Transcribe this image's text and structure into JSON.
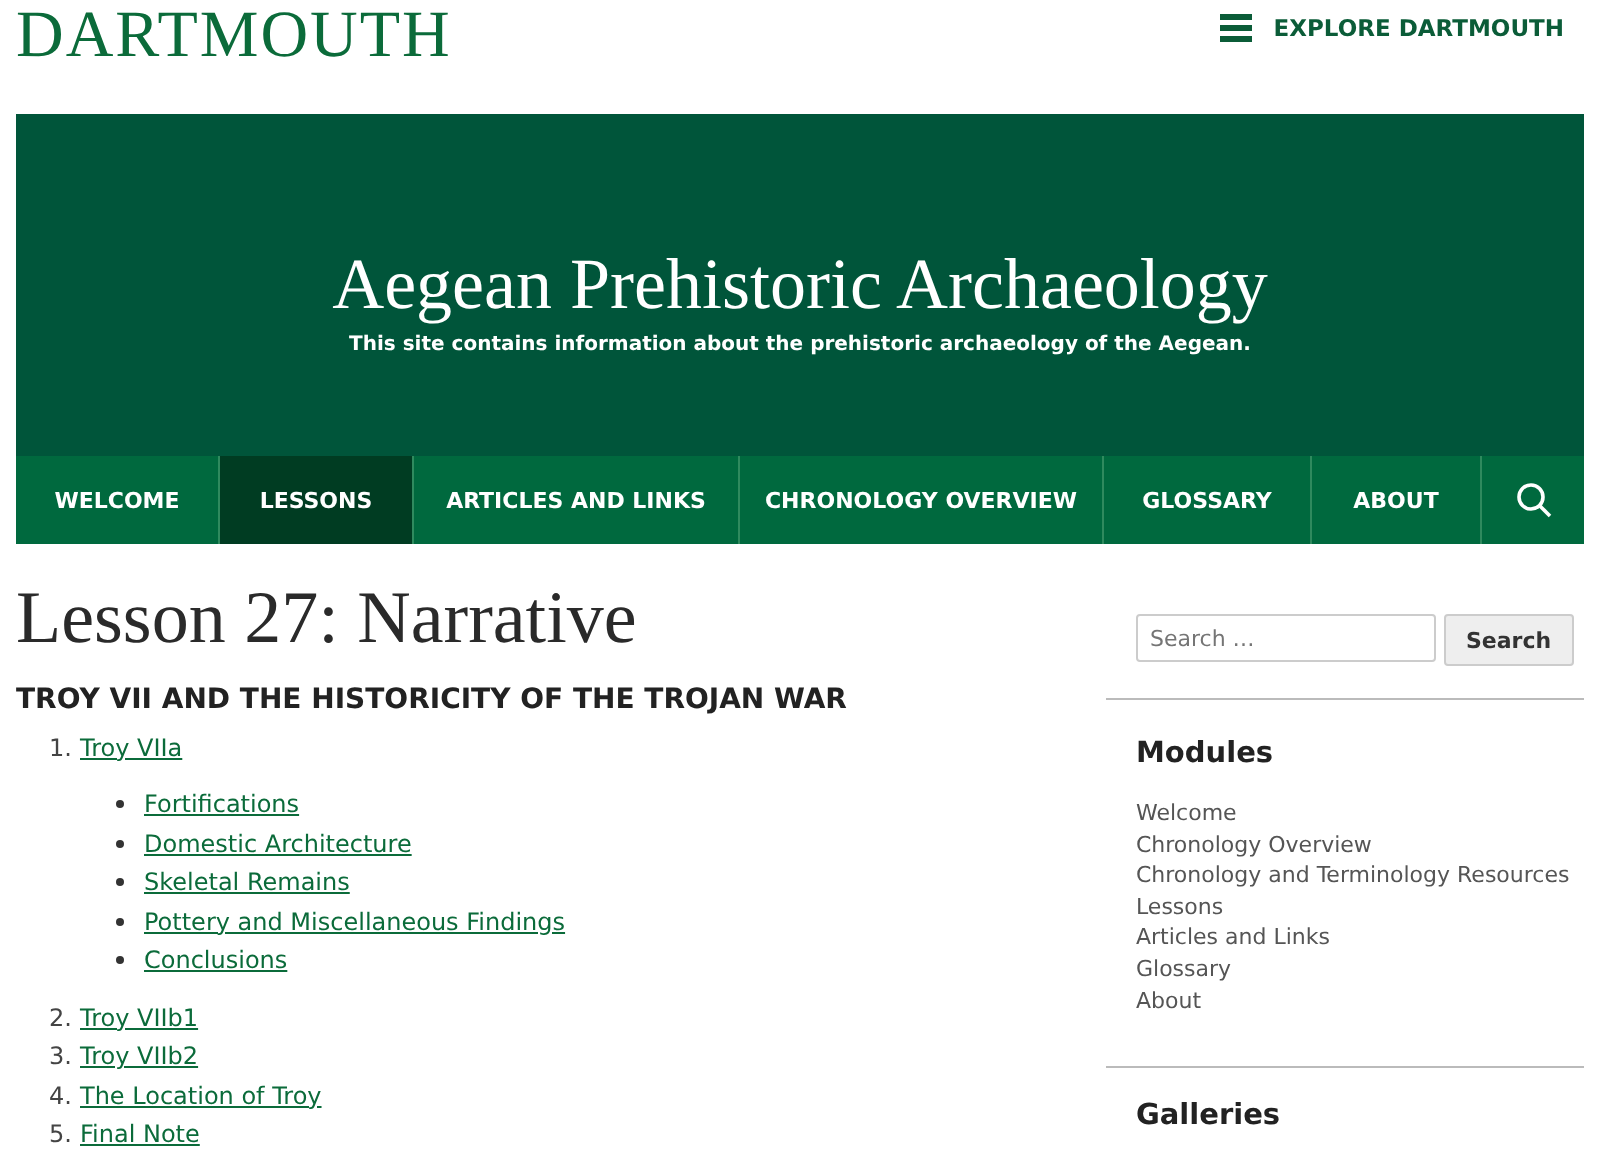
{
  "header": {
    "logo": "DARTMOUTH",
    "explore": "EXPLORE DARTMOUTH"
  },
  "banner": {
    "title": "Aegean Prehistoric Archaeology",
    "subtitle": "This site contains information about the prehistoric archaeology of the Aegean."
  },
  "nav": [
    {
      "label": "WELCOME",
      "selected": false
    },
    {
      "label": "LESSONS",
      "selected": true
    },
    {
      "label": "ARTICLES AND LINKS",
      "selected": false
    },
    {
      "label": "CHRONOLOGY OVERVIEW",
      "selected": false
    },
    {
      "label": "GLOSSARY",
      "selected": false
    },
    {
      "label": "ABOUT",
      "selected": false
    }
  ],
  "main": {
    "title": "Lesson 27: Narrative",
    "subtitle": "TROY VII AND THE HISTORICITY OF THE TROJAN WAR",
    "items": [
      {
        "number": "1.",
        "label": "Troy VIIa",
        "children": [
          "Fortifications",
          "Domestic Architecture",
          "Skeletal Remains",
          "Pottery and Miscellaneous Findings",
          "Conclusions"
        ]
      },
      {
        "number": "2.",
        "label": "Troy VIIb1"
      },
      {
        "number": "3.",
        "label": "Troy VIIb2"
      },
      {
        "number": "4.",
        "label": "The Location of Troy"
      },
      {
        "number": "5.",
        "label": "Final Note"
      }
    ]
  },
  "sidebar": {
    "search": {
      "placeholder": "Search …",
      "button": "Search"
    },
    "modules": {
      "title": "Modules",
      "items": [
        "Welcome",
        "Chronology Overview",
        "Chronology and Terminology Resources",
        "Lessons",
        "Articles and Links",
        "Glossary",
        "About"
      ]
    },
    "galleries": {
      "title": "Galleries"
    }
  }
}
